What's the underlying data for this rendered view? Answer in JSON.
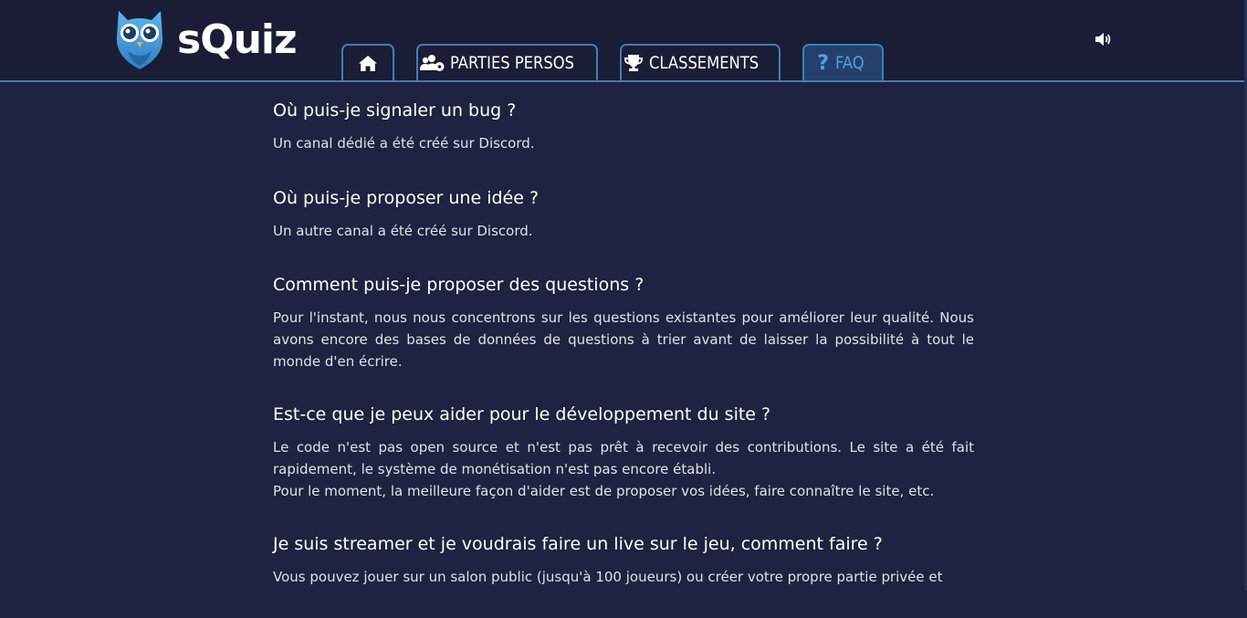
{
  "brand": {
    "name": "sQuiz",
    "logo_icon": "owl-icon"
  },
  "nav": {
    "tabs": [
      {
        "label": "",
        "icon": "home-icon"
      },
      {
        "label": "PARTIES PERSOS",
        "icon": "users-cog-icon"
      },
      {
        "label": "CLASSEMENTS",
        "icon": "trophy-icon"
      },
      {
        "label": "FAQ",
        "icon": "question-icon",
        "active": true
      }
    ],
    "sound_icon": "volume-icon"
  },
  "colors": {
    "background": "#1f2240",
    "header": "#1a1d35",
    "accent": "#3d7fb8",
    "active_tab_text": "#4aa3e6"
  },
  "faq": [
    {
      "question": "Où puis-je signaler un bug ?",
      "answer": "Un canal dédié a été créé sur Discord."
    },
    {
      "question": "Où puis-je proposer une idée ?",
      "answer": "Un autre canal a été créé sur Discord."
    },
    {
      "question": "Comment puis-je proposer des questions ?",
      "answer": "Pour l'instant, nous nous concentrons sur les questions existantes pour améliorer leur qualité. Nous avons encore des bases de données de questions à trier avant de laisser la possibilité à tout le monde d'en écrire."
    },
    {
      "question": "Est-ce que je peux aider pour le développement du site ?",
      "answer": "Le code n'est pas open source et n'est pas prêt à recevoir des contributions. Le site a été fait rapidement, le système de monétisation n'est pas encore établi.",
      "answer2": "Pour le moment, la meilleure façon d'aider est de proposer vos idées, faire connaître le site, etc."
    },
    {
      "question": "Je suis streamer et je voudrais faire un live sur le jeu, comment faire ?",
      "answer": "Vous pouvez jouer sur un salon public (jusqu'à 100 joueurs) ou créer votre propre partie privée et"
    }
  ]
}
